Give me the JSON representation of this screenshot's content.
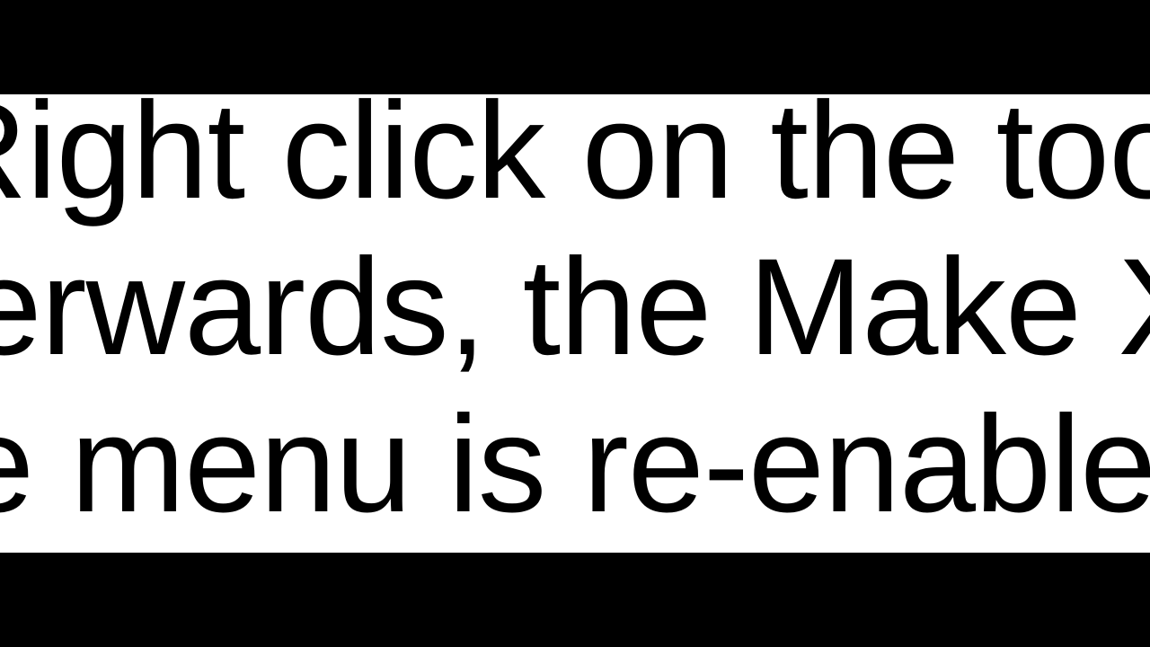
{
  "text": {
    "line1": "Right click on the toolb",
    "line2": "terwards, the Make X",
    "line3": "le menu is re-enable"
  }
}
